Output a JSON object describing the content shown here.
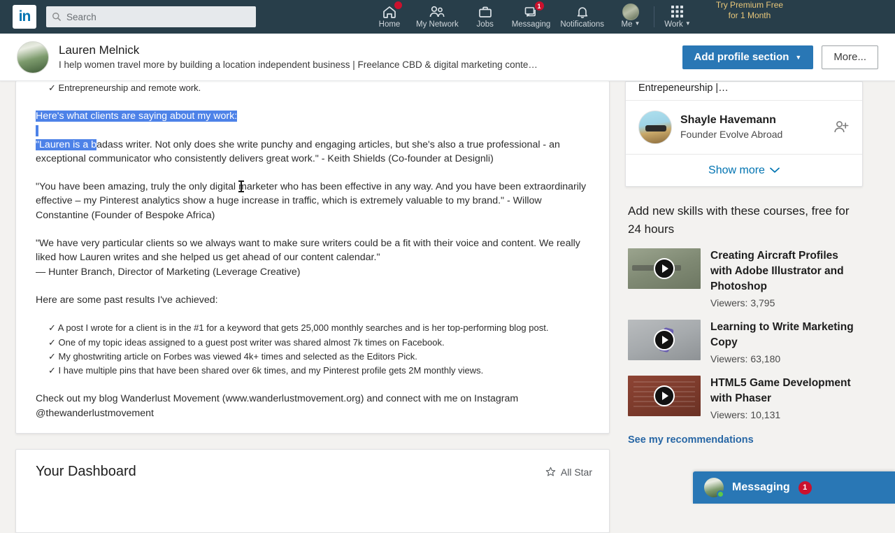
{
  "nav": {
    "logo": "in",
    "search_placeholder": "Search",
    "items": [
      {
        "label": "Home",
        "icon": "home-icon",
        "badge": ""
      },
      {
        "label": "My Network",
        "icon": "people-icon",
        "badge": ""
      },
      {
        "label": "Jobs",
        "icon": "briefcase-icon",
        "badge": ""
      },
      {
        "label": "Messaging",
        "icon": "message-icon",
        "badge": "1"
      },
      {
        "label": "Notifications",
        "icon": "bell-icon",
        "badge": ""
      }
    ],
    "me_label": "Me",
    "work_label": "Work",
    "premium_line1": "Try Premium Free",
    "premium_line2": "for 1 Month"
  },
  "profile_bar": {
    "name": "Lauren Melnick",
    "headline": "I help women travel more by building a location independent business | Freelance CBD & digital marketing conte…",
    "add_section_label": "Add profile section",
    "more_label": "More..."
  },
  "about": {
    "bullet_remote": "✓ Entrepreneurship and remote work.",
    "clients_heading": "Here's what clients are saying about my work:",
    "quote1_selected": "\"Lauren is a b",
    "quote1_rest": "adass writer. Not only does she write punchy and engaging articles, but she's also a true professional - an exceptional communicator who consistently delivers great work.\" - Keith Shields (Co-founder at Designli)",
    "quote2": "\"You have been amazing, truly the only digital marketer who has been effective in any way. And you have been extraordinarily effective – my Pinterest analytics show a huge increase in traffic, which is extremely valuable to my brand.\" - Willow Constantine (Founder of Bespoke Africa)",
    "quote3_line1": "\"We have very particular clients so we always want to make sure writers could be a fit with their voice and content. We really liked how Lauren writes and she helped us get ahead of our content calendar.\"",
    "quote3_line2": "— Hunter Branch, Director of Marketing (Leverage Creative)",
    "results_heading": "Here are some past results I've achieved:",
    "results": [
      "✓ A post I wrote for a client is in the #1 for a keyword that gets 25,000 monthly searches and is her top-performing blog post.",
      "✓ One of my topic ideas assigned to a guest post writer was shared almost 7k times on Facebook.",
      "✓ My ghostwriting article on Forbes was viewed 4k+ times and selected as the Editors Pick.",
      "✓ I have multiple pins that have been shared over 6k times, and my Pinterest profile gets 2M monthly views."
    ],
    "closing": "Check out my blog Wanderlust Movement (www.wanderlustmovement.org) and connect with me on Instagram @thewanderlustmovement"
  },
  "dashboard": {
    "title": "Your Dashboard",
    "allstar_label": "All Star",
    "star_icon": "star-outline-icon"
  },
  "people_also_viewed": {
    "cut_off_entry": "Entrepeneurship |…",
    "person": {
      "name": "Shayle Havemann",
      "subtitle": "Founder Evolve Abroad",
      "connect_icon": "add-person-icon"
    },
    "show_more_label": "Show more"
  },
  "courses": {
    "title": "Add new skills with these courses, free for 24 hours",
    "items": [
      {
        "title": "Creating Aircraft Profiles with Adobe Illustrator and Photoshop",
        "viewers": "Viewers: 3,795"
      },
      {
        "title": "Learning to Write Marketing Copy",
        "viewers": "Viewers: 63,180"
      },
      {
        "title": "HTML5 Game Development with Phaser",
        "viewers": "Viewers: 10,131"
      }
    ],
    "recommendations_label": "See my recommendations"
  },
  "messaging_dock": {
    "label": "Messaging",
    "badge": "1"
  },
  "colors": {
    "nav_bg": "#283e4a",
    "primary": "#2977b5",
    "link": "#0073b1",
    "badge_red": "#cb112d",
    "selection_blue": "#4d82e8",
    "premium_gold": "#e8c77a"
  }
}
